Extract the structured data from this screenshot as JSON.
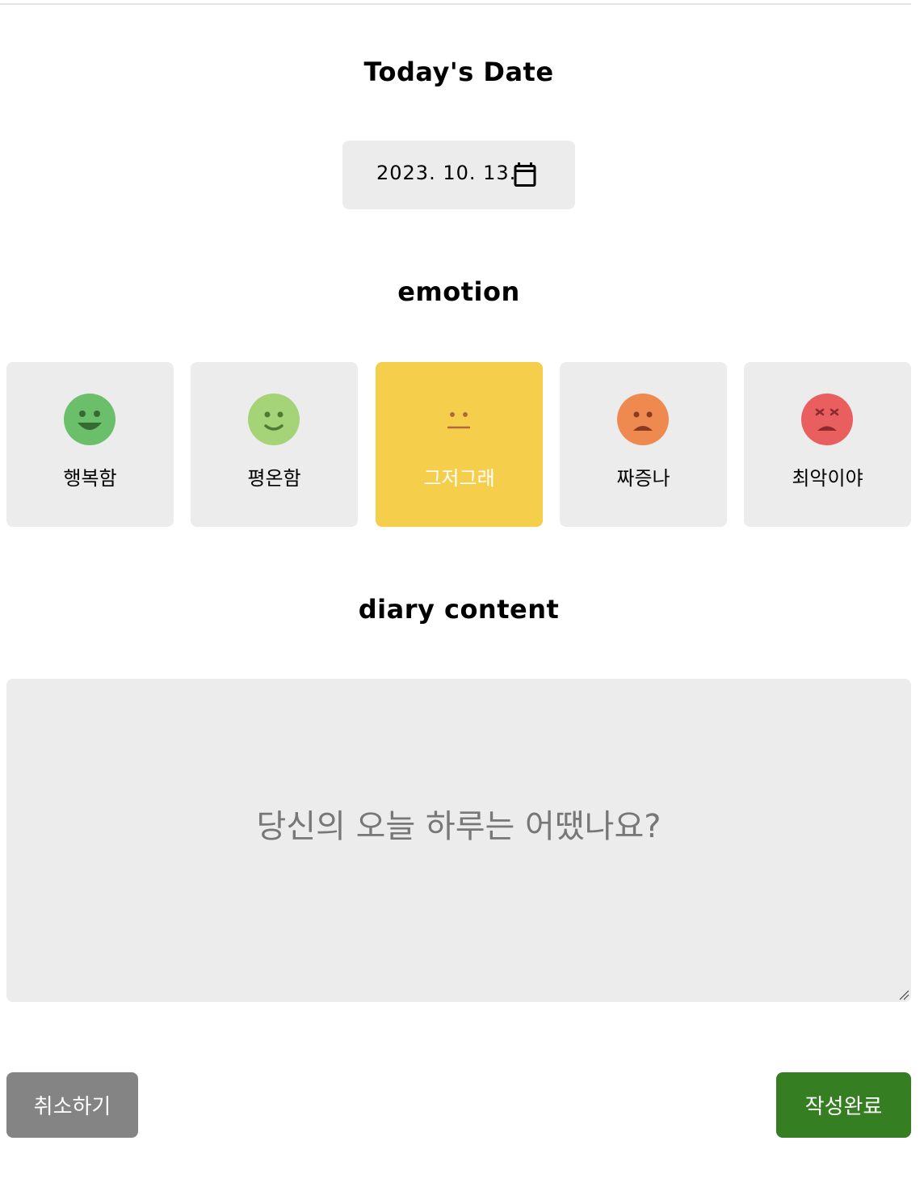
{
  "header": {
    "date_title": "Today's Date",
    "emotion_title": "emotion",
    "content_title": "diary content"
  },
  "date": {
    "value": "2023. 10. 13.",
    "icon": "calendar-icon"
  },
  "emotions": [
    {
      "label": "행복함",
      "color": "#6cbf6a",
      "icon": "laughing-face-icon",
      "selected": false
    },
    {
      "label": "평온함",
      "color": "#a5d478",
      "icon": "smiling-face-icon",
      "selected": false
    },
    {
      "label": "그저그래",
      "color": "#f5ce4c",
      "icon": "neutral-face-icon",
      "selected": true
    },
    {
      "label": "짜증나",
      "color": "#ee8a4f",
      "icon": "frowning-face-icon",
      "selected": false
    },
    {
      "label": "최악이야",
      "color": "#e95e5f",
      "icon": "dizzy-face-icon",
      "selected": false
    }
  ],
  "content": {
    "placeholder": "당신의 오늘 하루는 어땠나요?",
    "value": ""
  },
  "buttons": {
    "cancel_label": "취소하기",
    "submit_label": "작성완료",
    "cancel_color": "#848484",
    "submit_color": "#357e21"
  }
}
